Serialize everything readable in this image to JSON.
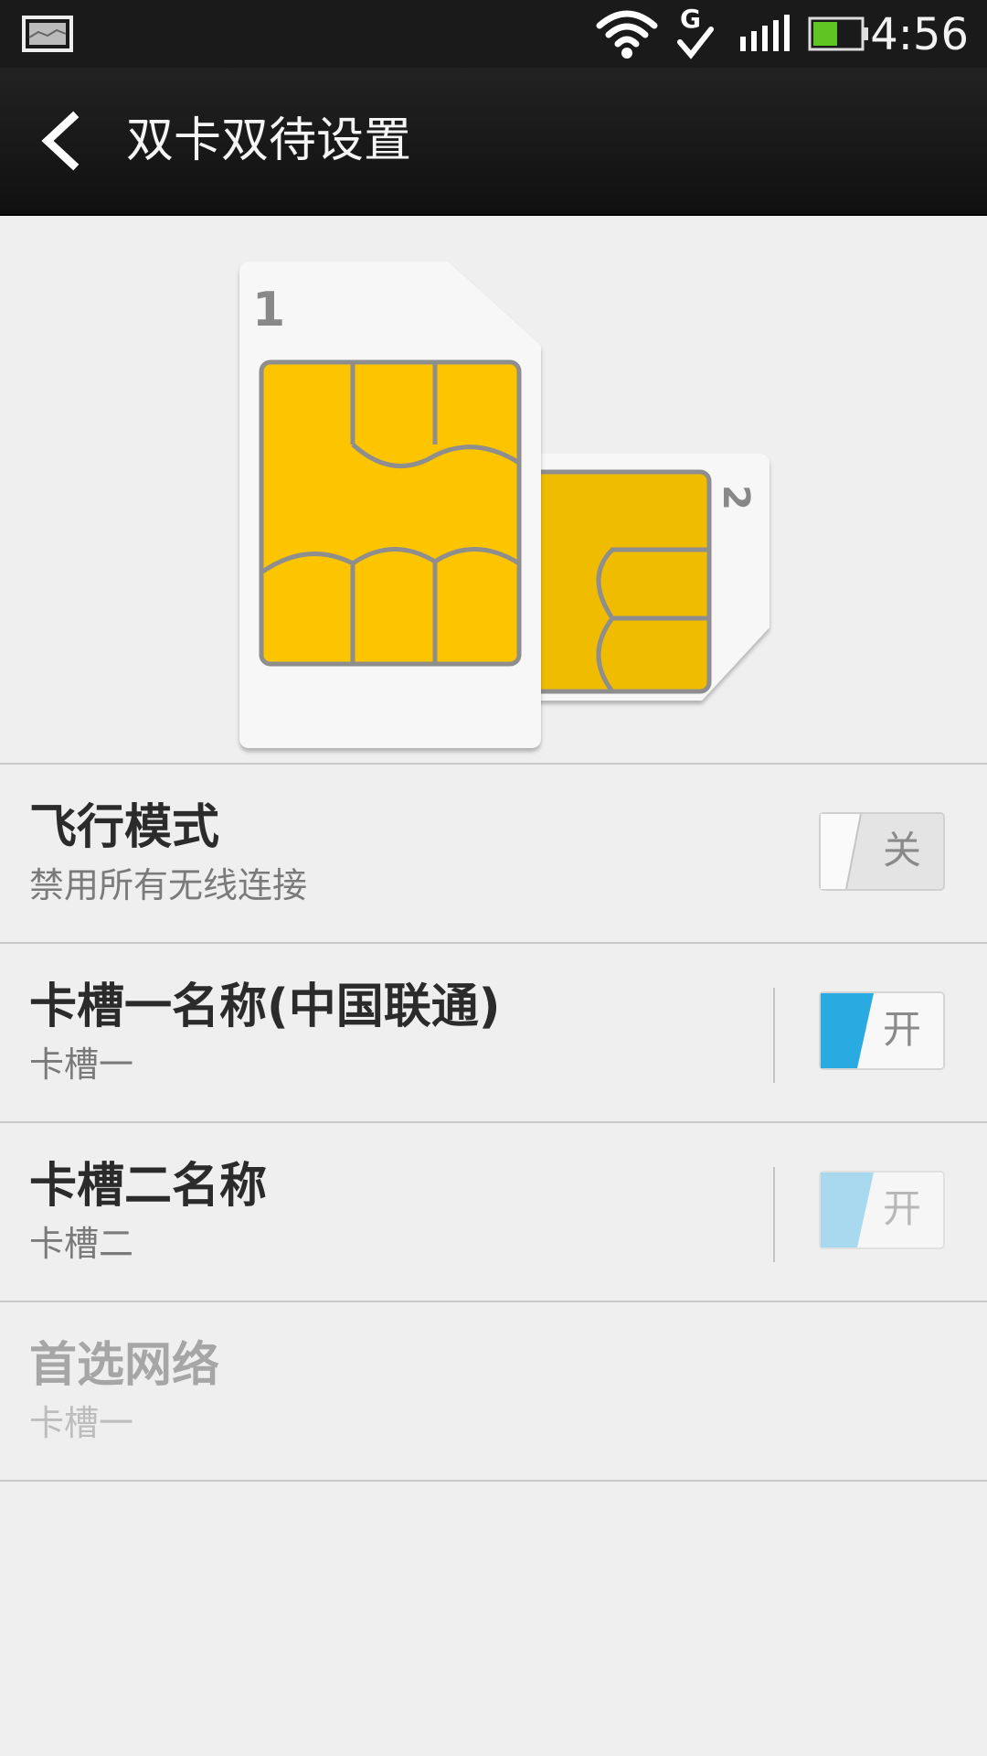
{
  "status_bar": {
    "time": "4:56",
    "icons": [
      "notification-image-icon",
      "wifi-icon",
      "g-data-icon",
      "signal-icon",
      "battery-icon"
    ]
  },
  "action_bar": {
    "title": "双卡双待设置",
    "back_icon": "chevron-left-icon"
  },
  "illustration": {
    "sim1_label": "1",
    "sim2_label": "2",
    "chip_color": "#fdc400"
  },
  "settings": [
    {
      "title": "飞行模式",
      "subtitle": "禁用所有无线连接",
      "toggle": "关",
      "state": "off"
    },
    {
      "title": "卡槽一名称(中国联通)",
      "subtitle": "卡槽一",
      "toggle": "开",
      "state": "on"
    },
    {
      "title": "卡槽二名称",
      "subtitle": "卡槽二",
      "toggle": "开",
      "state": "on-disabled"
    },
    {
      "title": "首选网络",
      "subtitle": "卡槽一",
      "state": "disabled"
    }
  ],
  "colors": {
    "accent": "#29abe2",
    "background": "#efefef"
  }
}
